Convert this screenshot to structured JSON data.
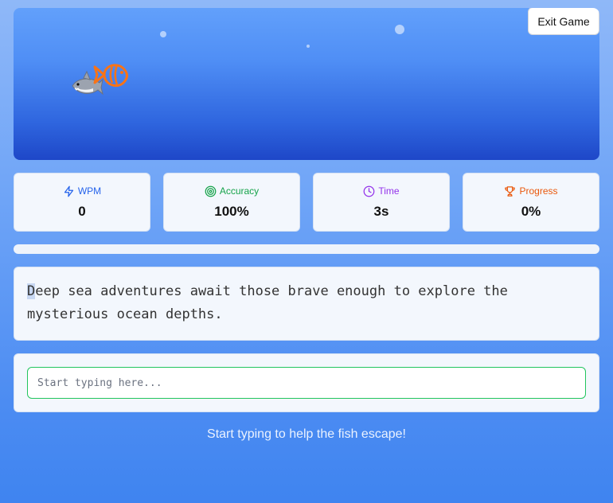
{
  "game": {
    "exit_label": "Exit Game",
    "predator_icon": "shark-icon",
    "prey_icon": "fish-icon"
  },
  "stats": [
    {
      "label": "WPM",
      "value": "0",
      "icon": "lightning-icon",
      "color": "#2563eb"
    },
    {
      "label": "Accuracy",
      "value": "100%",
      "icon": "target-icon",
      "color": "#16a34a"
    },
    {
      "label": "Time",
      "value": "3s",
      "icon": "clock-icon",
      "color": "#9333ea"
    },
    {
      "label": "Progress",
      "value": "0%",
      "icon": "trophy-icon",
      "color": "#ea580c"
    }
  ],
  "progress": {
    "fraction": 0
  },
  "passage": {
    "current_char": "D",
    "remaining": "eep sea adventures await those brave enough to explore the mysterious ocean depths."
  },
  "input": {
    "value": "",
    "placeholder": "Start typing here..."
  },
  "hint": "Start typing to help the fish escape!"
}
